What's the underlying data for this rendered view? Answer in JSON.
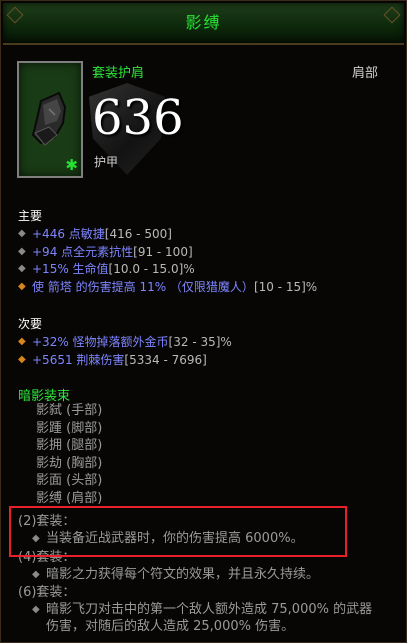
{
  "window": {
    "title": "影缚"
  },
  "item": {
    "type": "套装护肩",
    "slot": "肩部",
    "armor_value": "636",
    "armor_label": "护甲",
    "icon": "shoulder-armor-icon",
    "set_marker_icon": "set-asterisk-icon"
  },
  "primary": {
    "heading": "主要",
    "stats": [
      {
        "value": "+446 点敏捷",
        "range": " [416 - 500]"
      },
      {
        "value": "+94 点全元素抗性",
        "range": " [91 - 100]"
      },
      {
        "value": "+15% 生命值",
        "range": " [10.0 - 15.0]%"
      },
      {
        "value": "使 箭塔 的伤害提高 11% （仅限猎魔人）",
        "range": " [10 - 15]%"
      }
    ]
  },
  "secondary": {
    "heading": "次要",
    "stats": [
      {
        "value": "+32% 怪物掉落额外金币",
        "range": " [32 - 35]%"
      },
      {
        "value": "+5651 荆棘伤害",
        "range": " [5334 - 7696]"
      }
    ]
  },
  "set": {
    "name": "暗影装束",
    "pieces": [
      "影弑 (手部)",
      "影踵 (脚部)",
      "影拥 (腿部)",
      "影劫 (胸部)",
      "影面 (头部)",
      "影缚 (肩部)"
    ],
    "bonuses": [
      {
        "label": "(2)套装：",
        "desc": "当装备近战武器时，你的伤害提高 6000%。"
      },
      {
        "label": "(4)套装：",
        "desc": "暗影之力获得每个符文的效果，并且永久持续。"
      },
      {
        "label": "(6)套装：",
        "desc": "暗影飞刀对击中的第一个敌人额外造成 75,000% 的武器伤害，对随后的敌人造成 25,000% 伤害。"
      }
    ]
  },
  "colors": {
    "set_green": "#2fe43b",
    "magic_blue": "#7e85ff",
    "legendary_orange": "#d9861f",
    "highlight_red": "#e8202a"
  }
}
